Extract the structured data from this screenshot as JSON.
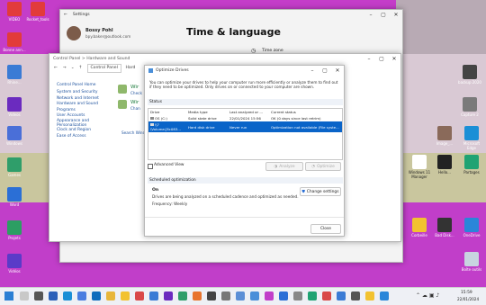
{
  "desktop": {
    "icons_left": [
      {
        "label": "VIDEO"
      },
      {
        "label": "Rocket_tools"
      },
      {
        "label": "Bonne ann..."
      },
      {
        "label": "Rhine..."
      },
      {
        "label": "Outlook"
      },
      {
        "label": "Videos"
      },
      {
        "label": "Windows"
      },
      {
        "label": "Games"
      },
      {
        "label": "Word"
      },
      {
        "label": "Projets"
      },
      {
        "label": "Windows Tools"
      },
      {
        "label": "Nicolas..."
      },
      {
        "label": "Vidéos"
      },
      {
        "label": "Dow..."
      }
    ],
    "icons_right": [
      {
        "label": "backup 2020"
      },
      {
        "label": "Capture 2"
      },
      {
        "label": "Image_..."
      },
      {
        "label": "Microsoft Edge"
      },
      {
        "label": "Windows 11 Manager"
      },
      {
        "label": "Hello..."
      },
      {
        "label": "Partages"
      },
      {
        "label": "OneDrive"
      },
      {
        "label": "Corbeille"
      },
      {
        "label": "Bad Disk..."
      },
      {
        "label": "Recycle Bin"
      },
      {
        "label": "Bad Dia..."
      },
      {
        "label": "Boîte outils"
      }
    ]
  },
  "settings": {
    "title": "Settings",
    "user_name": "Bossy Pohl",
    "user_email": "bpy.baker@outlook.com",
    "page_title": "Time & language",
    "item": "Time zone"
  },
  "control_panel": {
    "title": "Control Panel > Hardware and Sound",
    "breadcrumb_root": "Control Panel",
    "breadcrumb_child": "Hard",
    "nav": [
      "Control Panel Home",
      "System and Security",
      "Network and Internet",
      "Hardware and Sound",
      "Programs",
      "User Accounts",
      "Appearance and Personalization",
      "Clock and Region",
      "Ease of Access"
    ],
    "items": [
      {
        "title": "Wir",
        "sub": "Check"
      },
      {
        "title": "Wir",
        "sub": "Chan"
      }
    ],
    "search_link": "Search Wind"
  },
  "optimize_drives": {
    "title": "Optimize Drives",
    "description": "You can optimize your drives to help your computer run more efficiently or analyze them to find out if they need to be optimized. Only drives on or connected to your computer are shown.",
    "status_heading": "Status",
    "columns": [
      "Drive",
      "Media type",
      "Last analyzed or ...",
      "Current status"
    ],
    "rows": [
      {
        "drive": "OS (C:)",
        "media": "Solid state drive",
        "last": "22/01/2024 15:56",
        "status": "OK (0 days since last retrim)"
      },
      {
        "drive": "\\\\?\\Volume{8c083...",
        "media": "Hard disk drive",
        "last": "Never run",
        "status": "Optimization not available (File syste..."
      }
    ],
    "advanced_view": "Advanced View",
    "analyze_label": "Analyze",
    "optimize_label": "Optimize",
    "scheduled_heading": "Scheduled optimization",
    "scheduled_state": "On",
    "scheduled_desc": "Drives are being analyzed on a scheduled cadence and optimized as needed.",
    "frequency": "Frequency: Weekly",
    "change_settings_label": "Change settings",
    "close_label": "Close"
  },
  "taskbar": {
    "time": "15:59",
    "date": "22/01/2024"
  },
  "colors": {
    "magenta": "#c13ec9",
    "olive": "#c8c8a0",
    "accent": "#0a64c8",
    "selection": "#0a64c8"
  }
}
